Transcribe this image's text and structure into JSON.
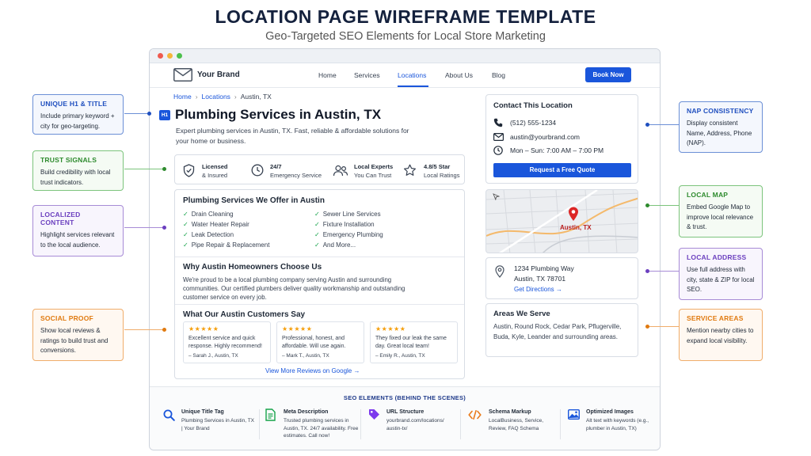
{
  "header": {
    "title": "LOCATION PAGE WIREFRAME TEMPLATE",
    "subtitle": "Geo-Targeted SEO Elements for Local Store Marketing"
  },
  "nav": {
    "brand": "Your Brand",
    "links": [
      "Home",
      "Services",
      "Locations",
      "About Us",
      "Blog"
    ],
    "active": "Locations",
    "cta": "Book Now"
  },
  "breadcrumb": [
    "Home",
    "Locations",
    "Austin, TX"
  ],
  "hero": {
    "tag": "H1",
    "title": "Plumbing Services in Austin, TX",
    "intro": "Expert plumbing services in Austin, TX. Fast, reliable & affordable solutions for your home or business."
  },
  "trust": [
    {
      "line1": "Licensed",
      "line2": "& Insured",
      "icon": "shield-icon"
    },
    {
      "line1": "24/7",
      "line2": "Emergency Service",
      "icon": "clock-icon"
    },
    {
      "line1": "Local Experts",
      "line2": "You Can Trust",
      "icon": "people-icon"
    },
    {
      "line1": "4.8/5 Star",
      "line2": "Local Ratings",
      "icon": "star-icon"
    }
  ],
  "services": {
    "title": "Plumbing Services We Offer in Austin",
    "left": [
      "Drain Cleaning",
      "Water Heater Repair",
      "Leak Detection",
      "Pipe Repair & Replacement"
    ],
    "right": [
      "Sewer Line Services",
      "Fixture Installation",
      "Emergency Plumbing",
      "And More..."
    ]
  },
  "why": {
    "title": "Why Austin Homeowners Choose Us",
    "text": "We're proud to be a local plumbing company serving Austin and surrounding communities. Our certified plumbers deliver quality workmanship and outstanding customer service on every job."
  },
  "reviews": {
    "title": "What Our Austin Customers Say",
    "items": [
      {
        "stars": "★★★★★",
        "text": "Excellent service and quick response. Highly recommend!",
        "name": "– Sarah J., Austin, TX"
      },
      {
        "stars": "★★★★★",
        "text": "Professional, honest, and affordable. Will use again.",
        "name": "– Mark T., Austin, TX"
      },
      {
        "stars": "★★★★★",
        "text": "They fixed our leak the same day. Great local team!",
        "name": "– Emily R., Austin, TX"
      }
    ],
    "more": "View More Reviews on Google →"
  },
  "contact": {
    "title": "Contact This Location",
    "phone": "(512) 555-1234",
    "email": "austin@yourbrand.com",
    "hours": "Mon – Sun: 7:00 AM – 7:00 PM",
    "cta": "Request a Free Quote"
  },
  "map": {
    "label": "Austin, TX"
  },
  "address": {
    "line1": "1234 Plumbing Way",
    "line2": "Austin, TX 78701",
    "directions": "Get Directions →"
  },
  "areas": {
    "title": "Areas We Serve",
    "text": "Austin, Round Rock, Cedar Park, Pflugerville, Buda, Kyle, Leander and surrounding areas."
  },
  "seo": {
    "title": "SEO ELEMENTS (BEHIND THE SCENES)",
    "items": [
      {
        "title": "Unique Title Tag",
        "desc": "Plumbing Services in Austin, TX | Your Brand",
        "icon": "search-icon"
      },
      {
        "title": "Meta Description",
        "desc": "Trusted plumbing services in Austin, TX. 24/7 availability. Free estimates. Call now!",
        "icon": "document-icon"
      },
      {
        "title": "URL Structure",
        "desc": "yourbrand.com/locations/ austin-tx/",
        "icon": "tag-icon"
      },
      {
        "title": "Schema Markup",
        "desc": "LocalBusiness, Service, Review, FAQ Schema",
        "icon": "code-icon"
      },
      {
        "title": "Optimized Images",
        "desc": "Alt text with keywords (e.g., plumber in Austin, TX)",
        "icon": "image-icon"
      }
    ]
  },
  "callouts": {
    "h1": {
      "title": "UNIQUE H1 & TITLE",
      "desc": "Include primary keyword + city for geo-targeting."
    },
    "trust": {
      "title": "TRUST SIGNALS",
      "desc": "Build credibility with local trust indicators."
    },
    "content": {
      "title": "LOCALIZED CONTENT",
      "desc": "Highlight services relevant to the local audience."
    },
    "social": {
      "title": "SOCIAL PROOF",
      "desc": "Show local reviews & ratings to build trust and conversions."
    },
    "nap": {
      "title": "NAP CONSISTENCY",
      "desc": "Display consistent Name, Address, Phone (NAP)."
    },
    "map": {
      "title": "LOCAL MAP",
      "desc": "Embed Google Map to improve local relevance & trust."
    },
    "address": {
      "title": "LOCAL ADDRESS",
      "desc": "Use full address with city, state & ZIP for local SEO."
    },
    "areas": {
      "title": "SERVICE AREAS",
      "desc": "Mention nearby cities to expand local visibility."
    }
  },
  "colors": {
    "accent": "#1a56db",
    "green": "#2e8b2e",
    "purple": "#6b3fbf",
    "orange": "#e07a10"
  }
}
